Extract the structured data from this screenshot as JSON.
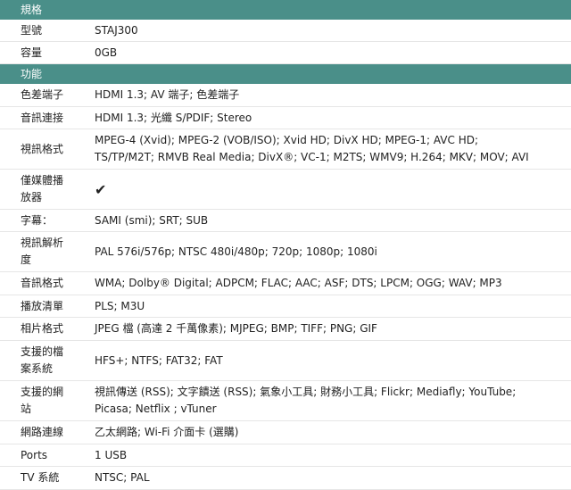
{
  "sections": [
    {
      "title": "規格",
      "rows": [
        {
          "label": "型號",
          "value": "STAJ300"
        },
        {
          "label": "容量",
          "value": "0GB"
        }
      ]
    },
    {
      "title": "功能",
      "rows": [
        {
          "label": "色差端子",
          "value": "HDMI 1.3; AV 端子; 色差端子"
        },
        {
          "label": "音訊連接",
          "value": "HDMI 1.3; 光纖 S/PDIF; Stereo"
        },
        {
          "label": "視訊格式",
          "value_line1": "MPEG-4 (Xvid); MPEG-2 (VOB/ISO); Xvid HD; DivX HD; MPEG-1; AVC HD;",
          "value_line2": "TS/TP/M2T; RMVB Real Media; DivX®; VC-1; M2TS; WMV9; H.264; MKV; MOV; AVI"
        },
        {
          "label_line1": "僅媒體播",
          "label_line2": "放器",
          "value": "✔"
        },
        {
          "label": "字幕：",
          "value": "SAMI (smi); SRT; SUB"
        },
        {
          "label_line1": "視訊解析",
          "label_line2": "度",
          "value": "PAL 576i/576p; NTSC 480i/480p; 720p; 1080p; 1080i"
        },
        {
          "label": "音訊格式",
          "value": "WMA; Dolby® Digital; ADPCM; FLAC; AAC; ASF; DTS; LPCM; OGG; WAV; MP3"
        },
        {
          "label": "播放清單",
          "value": "PLS; M3U"
        },
        {
          "label": "相片格式",
          "value": "JPEG 檔 (高達 2 千萬像素); MJPEG; BMP; TIFF; PNG; GIF"
        },
        {
          "label_line1": "支援的檔",
          "label_line2": "案系統",
          "value": "HFS+; NTFS; FAT32; FAT"
        },
        {
          "label_line1": "支援的網",
          "label_line2": "站",
          "value_line1": "視訊傳送 (RSS); 文字饋送 (RSS); 氣象小工具; 財務小工具; Flickr; Mediafly; YouTube;",
          "value_line2": "Picasa; Netflix ; vTuner"
        },
        {
          "label": "網路連線",
          "value": "乙太網路; Wi-Fi 介面卡 (選購)"
        },
        {
          "label": "Ports",
          "value": "1 USB"
        },
        {
          "label": "TV 系統",
          "value": "NTSC; PAL"
        }
      ]
    }
  ]
}
